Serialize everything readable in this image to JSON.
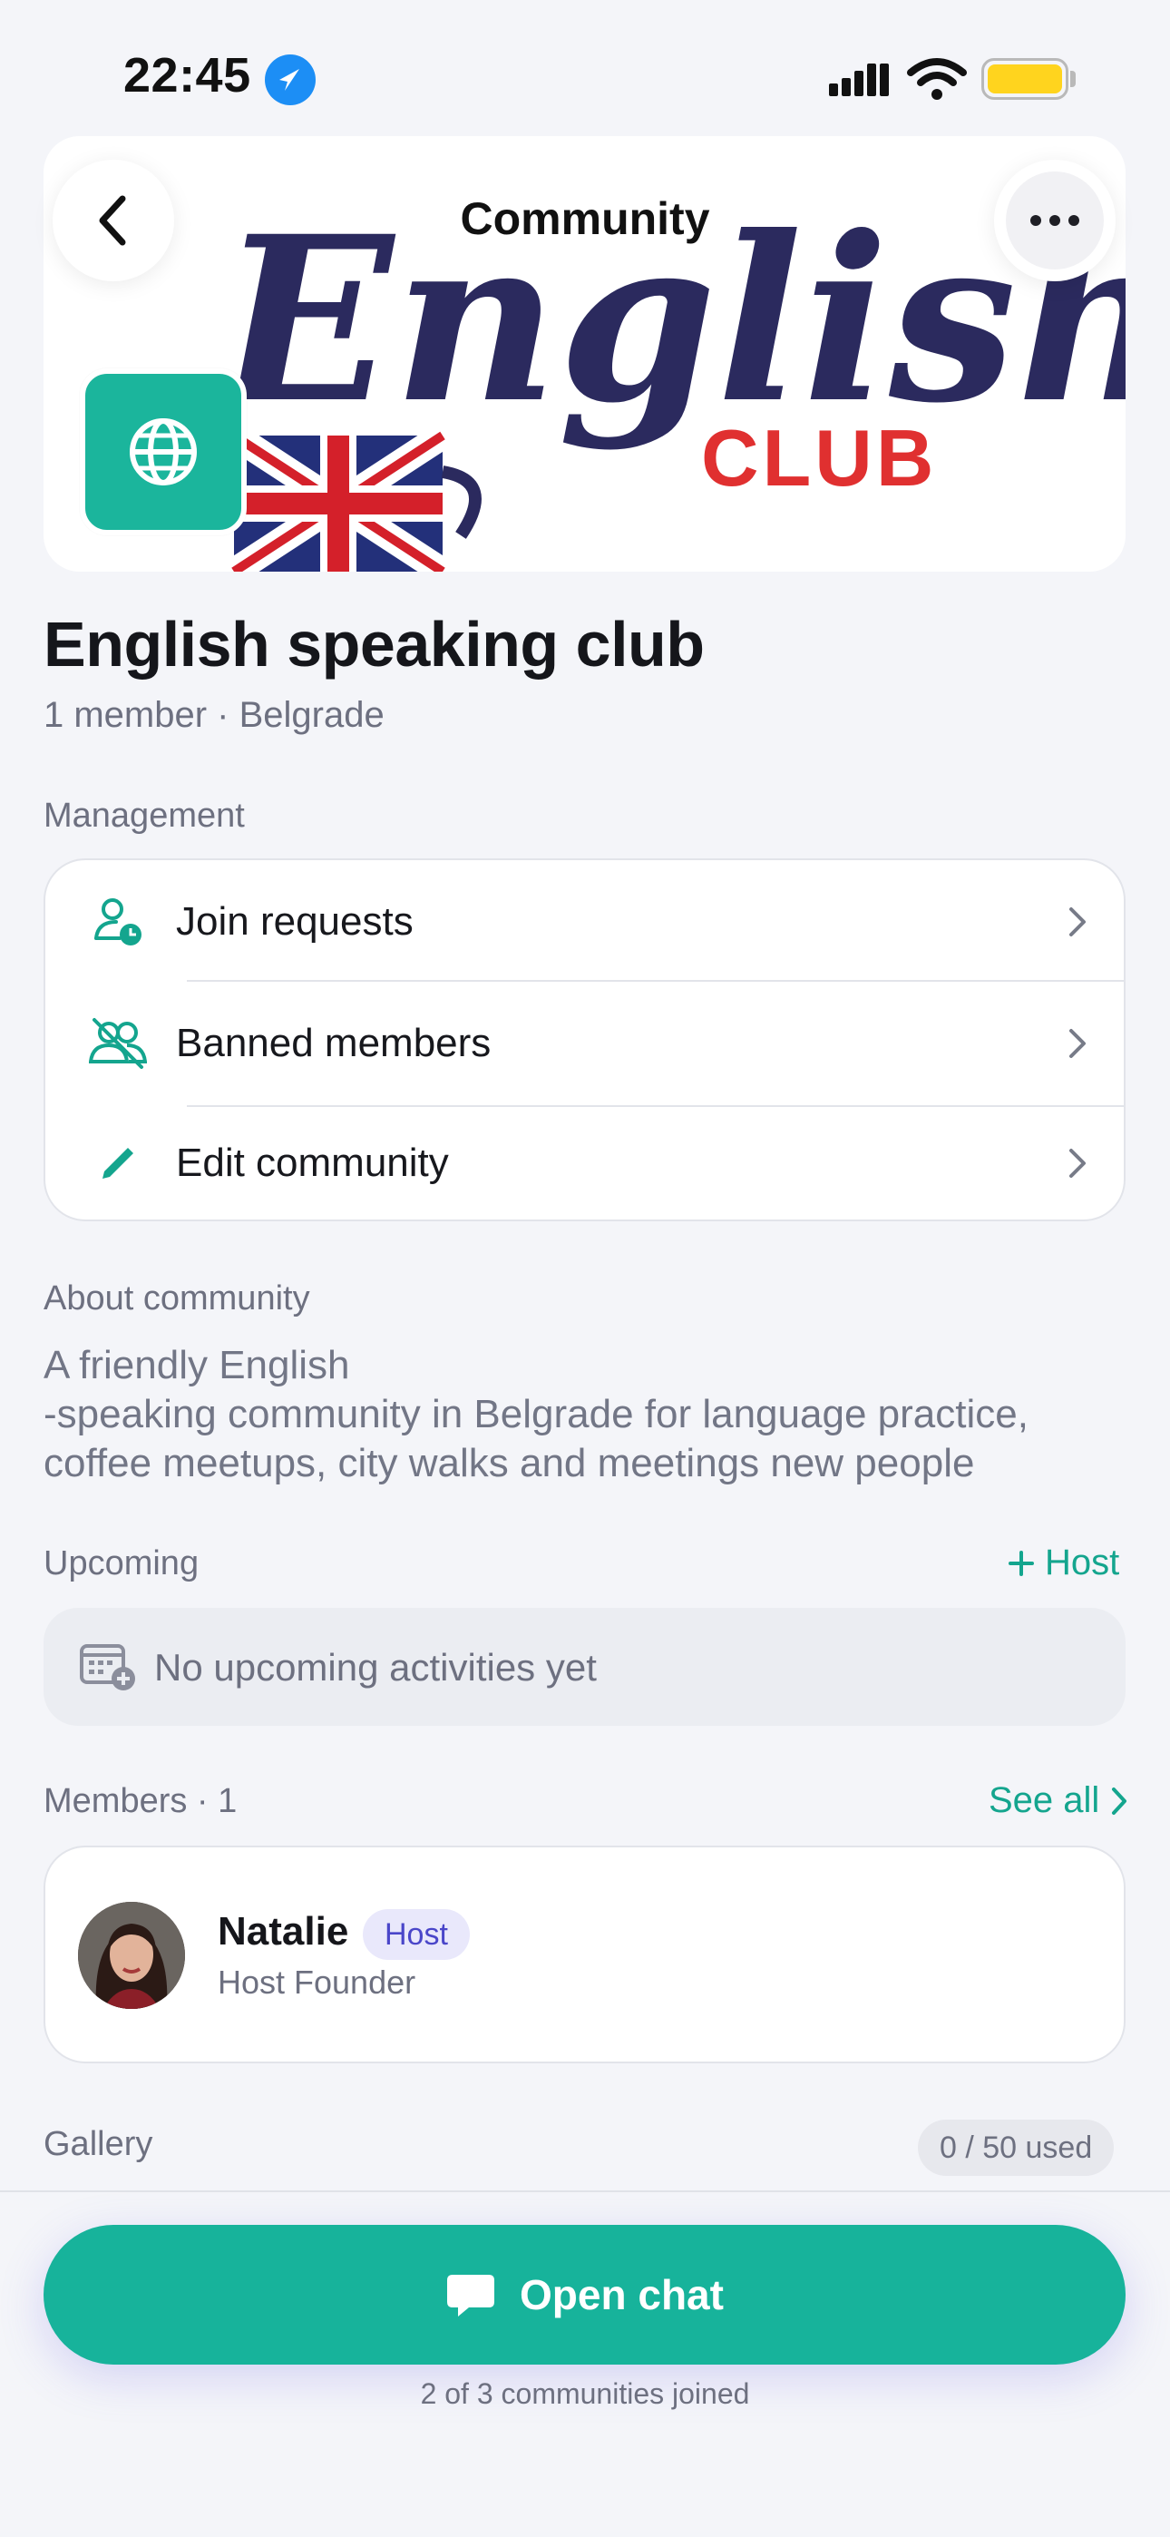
{
  "status_bar": {
    "time": "22:45"
  },
  "header": {
    "title": "Community"
  },
  "hero": {
    "banner_word": "English",
    "banner_club": "CLUB"
  },
  "club": {
    "name": "English speaking club",
    "meta": "1 member · Belgrade"
  },
  "management": {
    "label": "Management",
    "items": [
      {
        "label": "Join requests",
        "icon": "join-requests-icon"
      },
      {
        "label": "Banned members",
        "icon": "banned-members-icon"
      },
      {
        "label": "Edit community",
        "icon": "pencil-icon"
      }
    ]
  },
  "about": {
    "label": "About community",
    "lines": [
      "A friendly English",
      "-speaking community in Belgrade for language practice,",
      "coffee meetups, city walks and meetings new people"
    ]
  },
  "upcoming": {
    "label": "Upcoming",
    "action": "Host",
    "empty_text": "No upcoming activities yet"
  },
  "members": {
    "label": "Members · 1",
    "see_all": "See all",
    "list": [
      {
        "name": "Natalie",
        "badge": "Host",
        "role": "Host Founder"
      }
    ]
  },
  "gallery": {
    "label": "Gallery",
    "usage": "0 / 50 used"
  },
  "footer": {
    "button": "Open chat",
    "joined": "2 of 3 communities joined"
  },
  "colors": {
    "accent": "#17b39b",
    "background": "#f4f5f9",
    "badge": "#4a46c9"
  }
}
